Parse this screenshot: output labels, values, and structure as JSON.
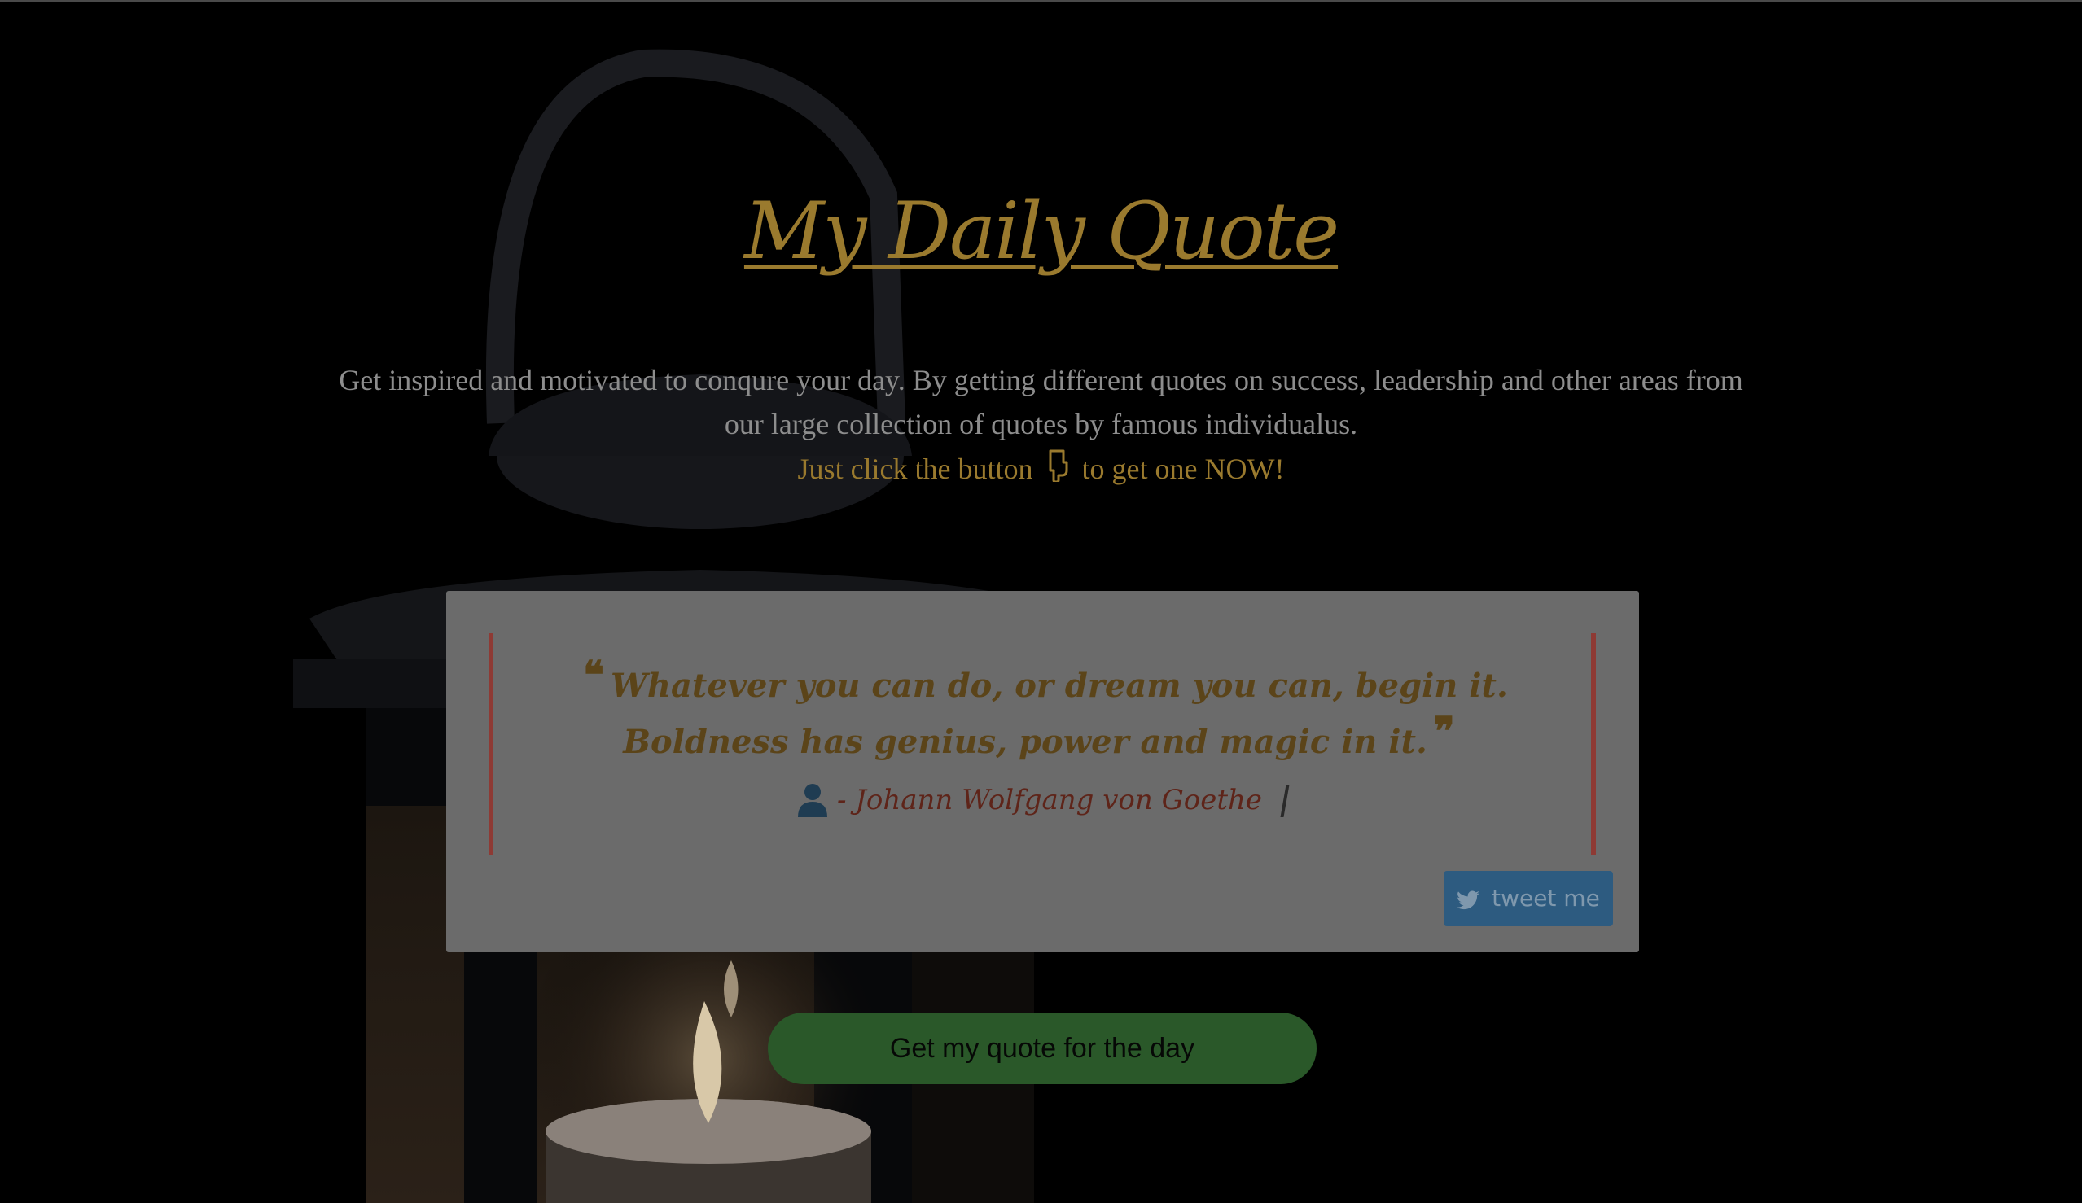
{
  "header": {
    "title": "My Daily Quote",
    "intro": "Get inspired and motivated to conqure your day. By getting different quotes on success, leadership and other areas from our large collection of quotes by famous individualus.",
    "cta_before": "Just click the button",
    "cta_icon": "pointing-down-hand-icon",
    "cta_after": "to get one NOW!"
  },
  "quote": {
    "open_mark": "❝",
    "text": "Whatever you can do, or dream you can, begin it. Boldness has genius, power and magic in it.",
    "close_mark": "❞",
    "author": "- Johann Wolfgang von Goethe",
    "author_icon": "user-icon"
  },
  "tweet": {
    "label": "tweet me",
    "icon": "twitter-bird-icon"
  },
  "get_quote": {
    "label": "Get my quote for the day"
  },
  "colors": {
    "background": "#000000",
    "title_gold": "#9a7a2e",
    "intro_gray": "#8d8d8d",
    "card_bg": "#6b6b6b",
    "quote_text": "#5b4419",
    "quote_border": "#8e3a34",
    "author_text": "#5e2419",
    "tweet_bg": "#2d5b80",
    "get_quote_bg": "#2a5829"
  }
}
